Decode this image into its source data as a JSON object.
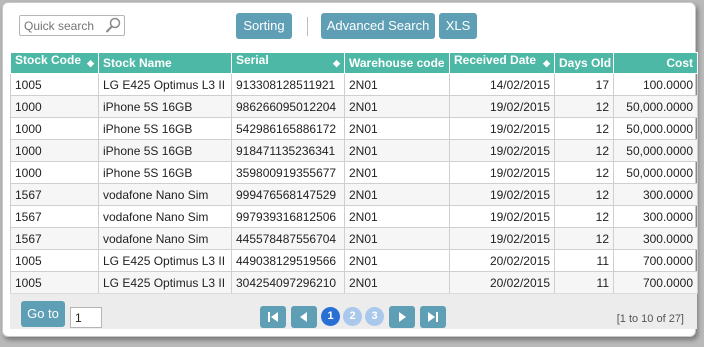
{
  "toolbar": {
    "search_placeholder": "Quick search",
    "sorting_label": "Sorting",
    "advanced_search_label": "Advanced Search",
    "xls_label": "XLS"
  },
  "table": {
    "columns": [
      "Stock Code",
      "Stock Name",
      "Serial",
      "Warehouse code",
      "Received Date",
      "Days Old",
      "Cost"
    ],
    "rows": [
      [
        "1005",
        "LG E425 Optimus L3 II",
        "913308128511921",
        "2N01",
        "14/02/2015",
        "17",
        "100.0000"
      ],
      [
        "1000",
        "iPhone 5S 16GB",
        "986266095012204",
        "2N01",
        "19/02/2015",
        "12",
        "50,000.0000"
      ],
      [
        "1000",
        "iPhone 5S 16GB",
        "542986165886172",
        "2N01",
        "19/02/2015",
        "12",
        "50,000.0000"
      ],
      [
        "1000",
        "iPhone 5S 16GB",
        "918471135236341",
        "2N01",
        "19/02/2015",
        "12",
        "50,000.0000"
      ],
      [
        "1000",
        "iPhone 5S 16GB",
        "359800919355677",
        "2N01",
        "19/02/2015",
        "12",
        "50,000.0000"
      ],
      [
        "1567",
        "vodafone Nano Sim",
        "999476568147529",
        "2N01",
        "19/02/2015",
        "12",
        "300.0000"
      ],
      [
        "1567",
        "vodafone Nano Sim",
        "997939316812506",
        "2N01",
        "19/02/2015",
        "12",
        "300.0000"
      ],
      [
        "1567",
        "vodafone Nano Sim",
        "445578487556704",
        "2N01",
        "19/02/2015",
        "12",
        "300.0000"
      ],
      [
        "1005",
        "LG E425 Optimus L3 II",
        "449038129519566",
        "2N01",
        "20/02/2015",
        "11",
        "700.0000"
      ],
      [
        "1005",
        "LG E425 Optimus L3 II",
        "304254097296210",
        "2N01",
        "20/02/2015",
        "11",
        "700.0000"
      ]
    ]
  },
  "footer": {
    "goto_label": "Go to",
    "goto_value": "1",
    "pages": [
      "1",
      "2",
      "3"
    ],
    "range_text": "[1 to 10 of 27]"
  },
  "colors": {
    "header_bg": "#4db8a6",
    "button_bg": "#5e9fb5",
    "page_active": "#2a6fd6",
    "page_inactive": "#a9c8ec"
  }
}
